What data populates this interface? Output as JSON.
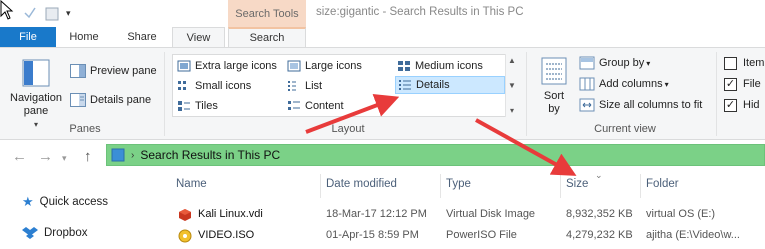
{
  "window": {
    "title": "size:gigantic - Search Results in This PC",
    "contextual_tab_group": "Search Tools"
  },
  "tabs": {
    "file": "File",
    "home": "Home",
    "share": "Share",
    "view": "View",
    "search": "Search"
  },
  "ribbon": {
    "panes": {
      "group_label": "Panes",
      "navigation_pane": "Navigation pane",
      "preview_pane": "Preview pane",
      "details_pane": "Details pane"
    },
    "layout": {
      "group_label": "Layout",
      "extra_large_icons": "Extra large icons",
      "large_icons": "Large icons",
      "medium_icons": "Medium icons",
      "small_icons": "Small icons",
      "list": "List",
      "details": "Details",
      "tiles": "Tiles",
      "content": "Content",
      "selected": "Details"
    },
    "current_view": {
      "group_label": "Current view",
      "sort_by": "Sort by",
      "group_by": "Group by",
      "add_columns": "Add columns",
      "size_all_columns": "Size all columns to fit"
    },
    "show_hide": {
      "item_check_boxes": "Item",
      "file_name_extensions": "File",
      "hidden_items": "Hid"
    }
  },
  "address": {
    "location": "Search Results in This PC"
  },
  "nav_pane": {
    "items": [
      "Quick access",
      "Dropbox"
    ]
  },
  "columns": {
    "name": "Name",
    "date_modified": "Date modified",
    "type": "Type",
    "size": "Size",
    "folder": "Folder"
  },
  "files": [
    {
      "name": "Kali Linux.vdi",
      "date": "18-Mar-17 12:12 PM",
      "type": "Virtual Disk Image",
      "size": "8,932,352 KB",
      "folder": "virtual OS (E:)"
    },
    {
      "name": "VIDEO.ISO",
      "date": "01-Apr-15 8:59 PM",
      "type": "PowerISO File",
      "size": "4,279,232 KB",
      "folder": "ajitha (E:\\Video\\w..."
    }
  ],
  "colors": {
    "file_tab": "#1979ca",
    "search_tools_tab": "#f7d9c6",
    "address_bar": "#7bd187",
    "selected_layout": "#cce8ff",
    "annotation_arrow": "#e83b3b"
  }
}
